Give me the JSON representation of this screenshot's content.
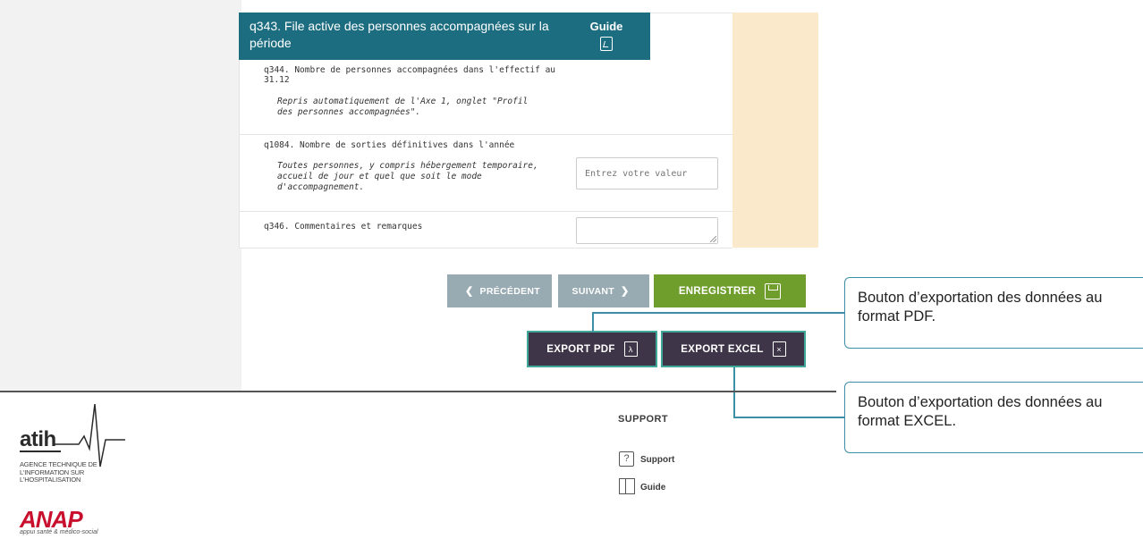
{
  "form": {
    "section_title": "q343. File active des personnes accompagnées sur la période",
    "guide_label": "Guide",
    "questions": [
      {
        "label": "q344. Nombre de personnes accompagnées dans l'effectif au 31.12",
        "help": "Repris automatiquement de l'Axe 1, onglet \"Profil des personnes accompagnées\"."
      },
      {
        "label": "q1084. Nombre de sorties définitives dans l'année",
        "help": "Toutes personnes, y compris hébergement temporaire, accueil de jour et quel que soit le mode d'accompagnement.",
        "input_placeholder": "Entrez votre valeur"
      },
      {
        "label": "q346. Commentaires et remarques"
      }
    ]
  },
  "nav": {
    "prev_label": "PRÉCÉDENT",
    "next_label": "SUIVANT",
    "save_label": "ENREGISTRER"
  },
  "export": {
    "pdf_label": "EXPORT PDF",
    "excel_label": "EXPORT EXCEL"
  },
  "callouts": {
    "pdf": "Bouton d’exportation des données au format PDF.",
    "excel": "Bouton d’exportation des données au format EXCEL."
  },
  "footer": {
    "atih_logo": "atih",
    "atih_subtitle": "AGENCE TECHNIQUE DE L'INFORMATION SUR L'HOSPITALISATION",
    "anap_logo": "ANAP",
    "anap_tagline": "appui santé & médico-social",
    "support_title": "SUPPORT",
    "support_link": "Support",
    "guide_link": "Guide"
  },
  "colors": {
    "header_teal": "#1d6d80",
    "save_green": "#6f9e2c",
    "nav_grey": "#98aab2",
    "export_dark": "#3f3548",
    "export_border": "#3fa89b",
    "beige": "#fbe9cb",
    "callout_border": "#3d8fa8",
    "anap_red": "#c8102e"
  }
}
